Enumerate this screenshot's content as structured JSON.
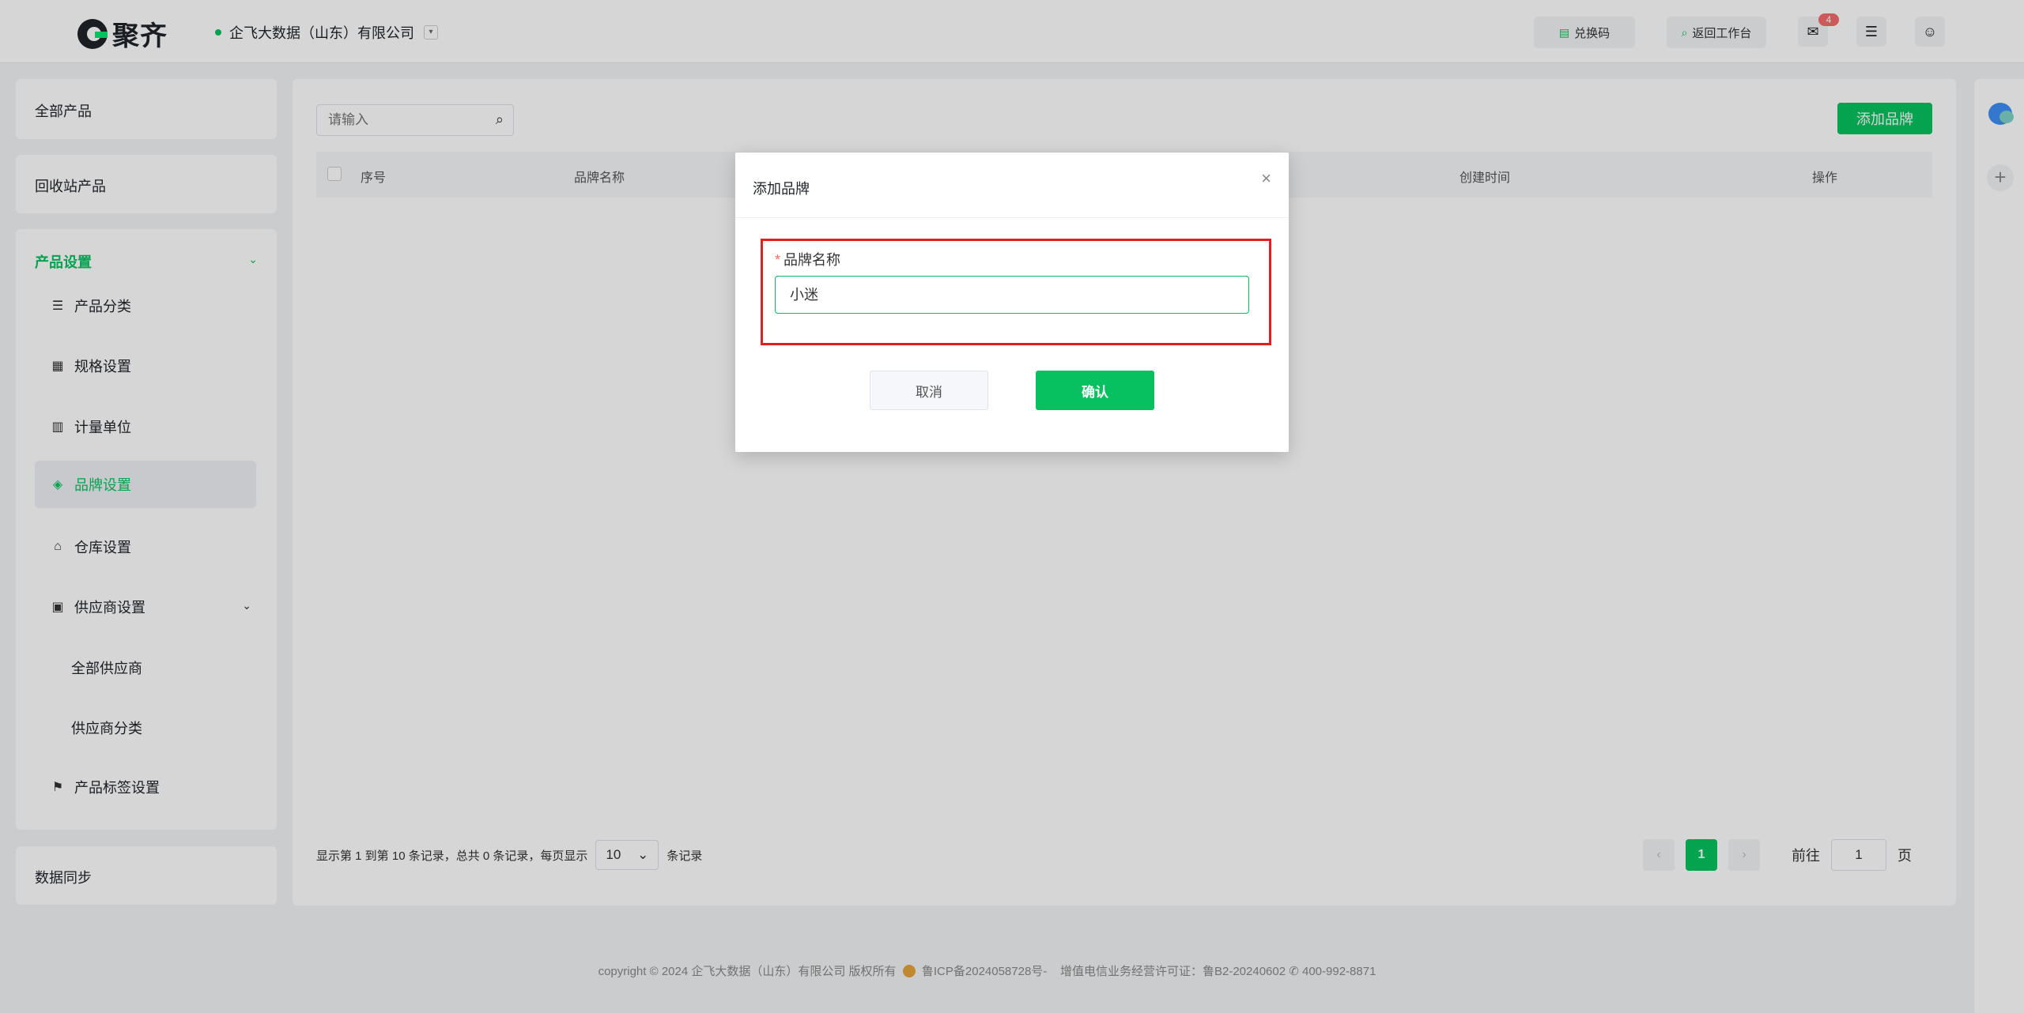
{
  "header": {
    "logo_text": "聚齐",
    "company": "企飞大数据（山东）有限公司",
    "redeem_label": "兑换码",
    "workbench_label": "返回工作台",
    "mail_badge": "4",
    "accent_color": "#07c160"
  },
  "sidebar": {
    "all_products": "全部产品",
    "recycle": "回收站产品",
    "settings_title": "产品设置",
    "items": [
      {
        "label": "产品分类",
        "icon": "list-icon"
      },
      {
        "label": "规格设置",
        "icon": "spec-icon"
      },
      {
        "label": "计量单位",
        "icon": "unit-icon"
      },
      {
        "label": "品牌设置",
        "icon": "tag-icon"
      },
      {
        "label": "仓库设置",
        "icon": "warehouse-icon"
      },
      {
        "label": "供应商设置",
        "icon": "supplier-icon"
      }
    ],
    "supplier_sub": [
      "全部供应商",
      "供应商分类"
    ],
    "tag_settings": "产品标签设置",
    "data_sync": "数据同步"
  },
  "main": {
    "search_placeholder": "请输入",
    "add_brand": "添加品牌",
    "columns": [
      "序号",
      "品牌名称",
      "创建时间",
      "操作"
    ],
    "pager_info": "显示第 1 到第 10 条记录，总共 0 条记录，每页显示",
    "page_size": "10",
    "records_suffix": "条记录",
    "current_page": "1",
    "goto_label": "前往",
    "goto_value": "1",
    "page_suffix": "页"
  },
  "footer": {
    "copyright": "copyright © 2024 企飞大数据（山东）有限公司 版权所有",
    "icp": "鲁ICP备2024058728号-",
    "license": "增值电信业务经营许可证：鲁B2-20240602",
    "phone": "400-992-8871"
  },
  "dialog": {
    "title": "添加品牌",
    "required_mark": "*",
    "field_label": "品牌名称",
    "field_value": "小迷",
    "cancel": "取消",
    "confirm": "确认"
  }
}
